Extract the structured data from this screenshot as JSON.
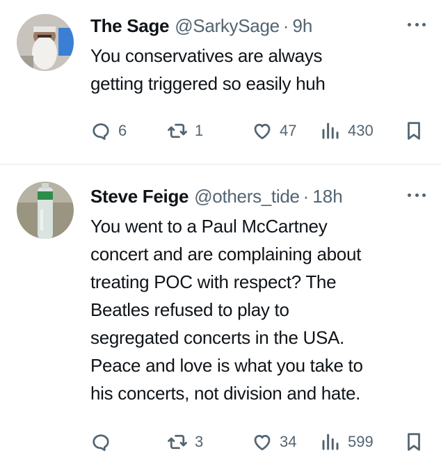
{
  "tweets": [
    {
      "display_name": "The Sage",
      "handle": "@SarkySage",
      "separator": "·",
      "time": "9h",
      "text": "You conservatives are always\ngetting triggered so easily huh",
      "stats": {
        "replies": "6",
        "retweets": "1",
        "likes": "47",
        "views": "430"
      },
      "avatar_colors": {
        "bg": "#c8c3bd",
        "beard": "#f2f0ec",
        "skin": "#9c7a66",
        "accent": "#3b7fd4"
      }
    },
    {
      "display_name": "Steve Feige",
      "handle": "@others_tide",
      "separator": "·",
      "time": "18h",
      "text": "You went to a Paul McCartney\nconcert and are complaining about\ntreating POC with respect? The\nBeatles refused to play to\nsegregated concerts in the USA.\nPeace and love is what you take to\nhis concerts, not division and hate.",
      "stats": {
        "replies": "",
        "retweets": "3",
        "likes": "34",
        "views": "599"
      },
      "avatar_colors": {
        "bg": "#9a9580",
        "bottle": "#d9e3e0",
        "label": "#2e8c4a"
      }
    }
  ],
  "icons": {
    "reply": "reply-icon",
    "retweet": "retweet-icon",
    "like": "heart-icon",
    "views": "analytics-icon",
    "bookmark": "bookmark-icon",
    "more": "more-icon"
  },
  "colors": {
    "text": "#0f1419",
    "muted": "#536471",
    "divider": "#eff3f4"
  }
}
